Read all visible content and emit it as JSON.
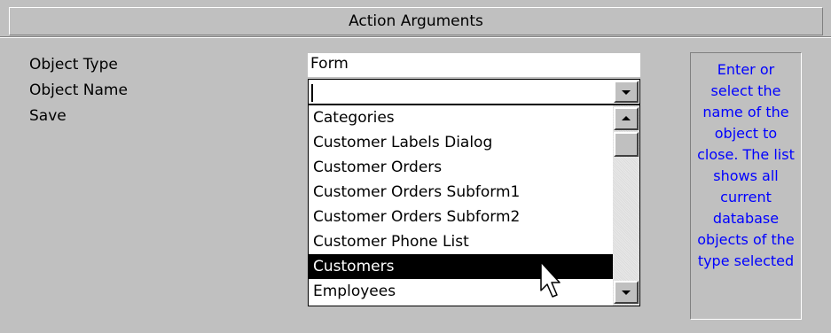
{
  "header": {
    "title": "Action Arguments"
  },
  "labels": {
    "object_type": "Object Type",
    "object_name": "Object Name",
    "save": "Save"
  },
  "fields": {
    "object_type_value": "Form",
    "object_name_value": ""
  },
  "dropdown": {
    "items": [
      "Categories",
      "Customer Labels Dialog",
      "Customer Orders",
      "Customer Orders Subform1",
      "Customer Orders Subform2",
      "Customer Phone List",
      "Customers",
      "Employees"
    ],
    "selected_item": "Customers"
  },
  "help": {
    "text": "Enter or select the name of the object to close. The list shows all current database objects of the type selected"
  },
  "colors": {
    "background": "#c0c0c0",
    "help_text": "#0000ff",
    "selection_bg": "#000000",
    "selection_fg": "#ffffff"
  },
  "icons": {
    "dropdown_arrow": "chevron-down-icon",
    "scroll_up": "scroll-up-icon",
    "scroll_down": "scroll-down-icon",
    "pointer": "mouse-pointer-icon"
  }
}
